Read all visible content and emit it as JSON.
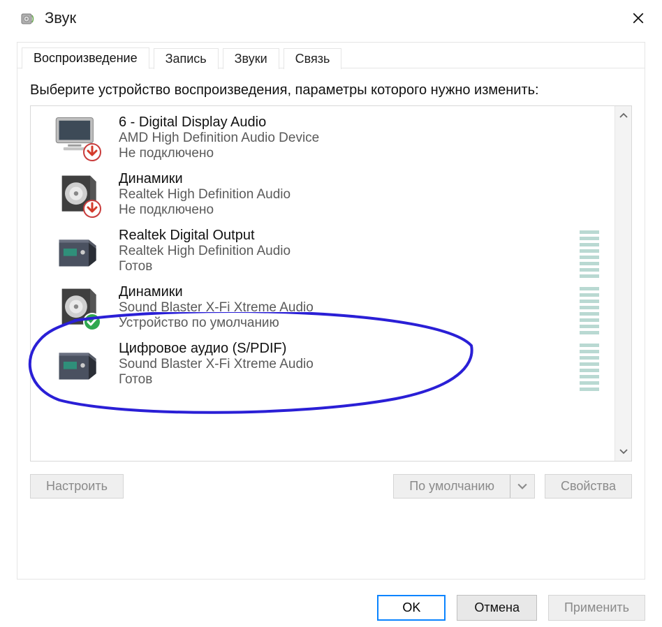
{
  "window": {
    "title": "Звук"
  },
  "tabs": [
    {
      "label": "Воспроизведение",
      "active": true
    },
    {
      "label": "Запись",
      "active": false
    },
    {
      "label": "Звуки",
      "active": false
    },
    {
      "label": "Связь",
      "active": false
    }
  ],
  "instructions": "Выберите устройство воспроизведения, параметры которого нужно изменить:",
  "devices": [
    {
      "name": "6 - Digital Display Audio",
      "description": "AMD High Definition Audio Device",
      "status": "Не подключено",
      "icon": "monitor",
      "badge": "disconnected",
      "vu": false
    },
    {
      "name": "Динамики",
      "description": "Realtek High Definition Audio",
      "status": "Не подключено",
      "icon": "speaker",
      "badge": "disconnected",
      "vu": false
    },
    {
      "name": "Realtek Digital Output",
      "description": "Realtek High Definition Audio",
      "status": "Готов",
      "icon": "digital-box",
      "badge": null,
      "vu": true
    },
    {
      "name": "Динамики",
      "description": "Sound Blaster X-Fi Xtreme Audio",
      "status": "Устройство по умолчанию",
      "icon": "speaker",
      "badge": "default",
      "vu": true,
      "highlight": true
    },
    {
      "name": "Цифровое аудио (S/PDIF)",
      "description": "Sound Blaster X-Fi Xtreme Audio",
      "status": "Готов",
      "icon": "digital-box",
      "badge": null,
      "vu": true
    }
  ],
  "tabButtons": {
    "configure": "Настроить",
    "setDefault": "По умолчанию",
    "properties": "Свойства"
  },
  "dialogButtons": {
    "ok": "OK",
    "cancel": "Отмена",
    "apply": "Применить"
  }
}
